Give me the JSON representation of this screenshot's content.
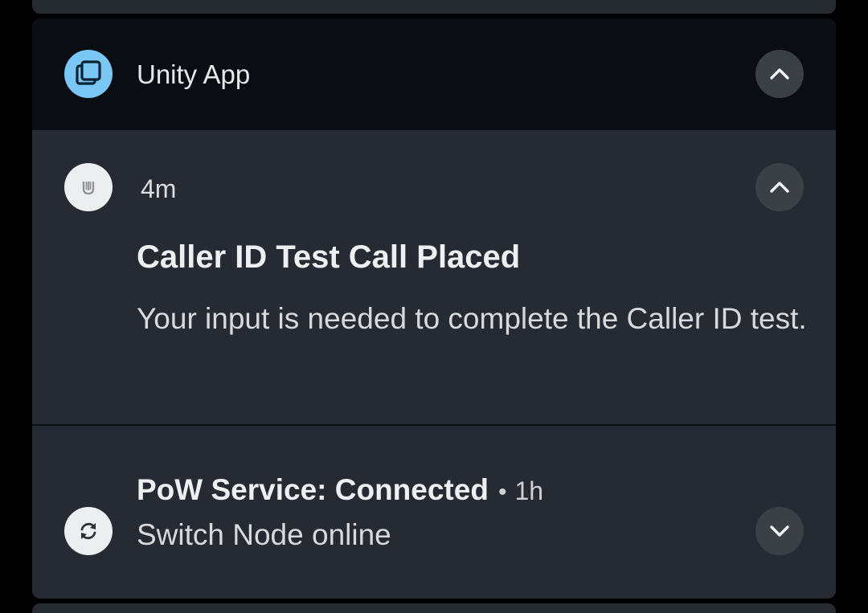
{
  "group": {
    "app_name": "Unity App",
    "app_icon": "copy-stack-icon",
    "expand_icon": "chevron-up-icon"
  },
  "notification_1": {
    "icon": "unity-u-icon",
    "time": "4m",
    "title": "Caller ID Test Call Placed",
    "body": "Your input is needed to complete the Caller ID test.",
    "expand_icon": "chevron-up-icon"
  },
  "notification_2": {
    "icon": "sync-icon",
    "title": "PoW Service: Connected",
    "separator": "•",
    "time": "1h",
    "body": "Switch Node online",
    "expand_icon": "chevron-down-icon"
  },
  "colors": {
    "background": "#000000",
    "card": "#262a32",
    "group_header": "#0a0e14",
    "app_icon_bg": "#7ac7f5",
    "chevron_button_bg": "#3b3f46"
  }
}
